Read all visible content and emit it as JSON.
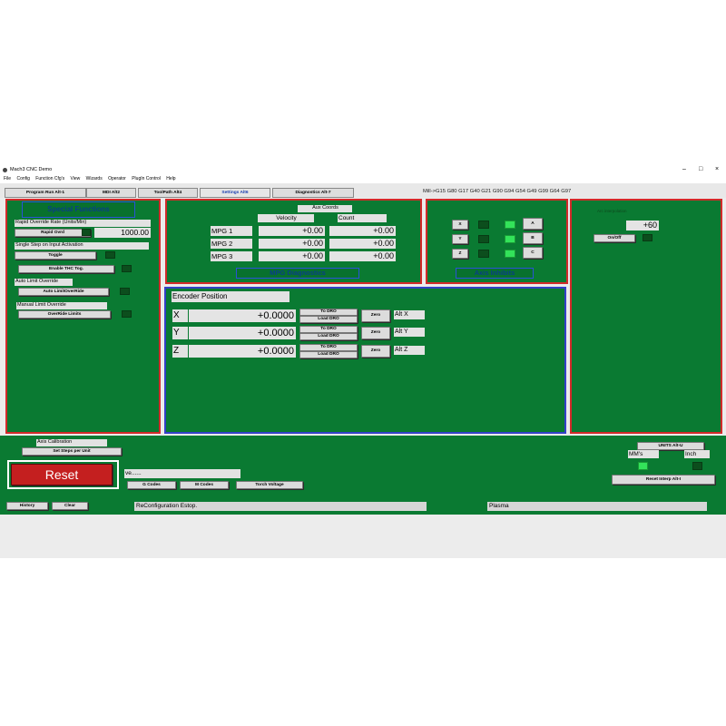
{
  "window": {
    "title": "Mach3 CNC Demo",
    "controls": [
      "–",
      "□",
      "×"
    ]
  },
  "menu": [
    "File",
    "Config",
    "Function Cfg's",
    "View",
    "Wizards",
    "Operator",
    "PlugIn Control",
    "Help"
  ],
  "tabs": [
    "Program Run Alt-1",
    "MDI Alt2",
    "ToolPath Alt4",
    "Settings Alt6",
    "Diagnostics Alt-7"
  ],
  "active_tab": "Settings Alt6",
  "gcode_line": "Mill->G15  G80 G17 G40 G21 G90 G94 G54 G49 G99 G64 G97",
  "special": {
    "title": "Special Functions",
    "rapid_override_label": "Rapid Override Rate (Units/Min)",
    "rapid_override_button": "Rapid Ovrd",
    "rapid_value": "1000.00",
    "single_step_label": "Single Step on Input Activation",
    "toggle_button": "Toggle",
    "enable_thc_button": "Enable THC Tog.",
    "auto_limit_label": "Auto Limit Override",
    "auto_limit_button": "Auto LimitOverRide",
    "manual_limit_label": "Manual Limit Override",
    "override_limits_button": "OverRide Limits"
  },
  "mpg": {
    "title": "MPG Diagnostics",
    "aux_coords": "Aux Coords",
    "velocity_header": "Velocity",
    "count_header": "Count",
    "rows": [
      {
        "name": "MPG 1",
        "velocity": "+0.00",
        "count": "+0.00"
      },
      {
        "name": "MPG 2",
        "velocity": "+0.00",
        "count": "+0.00"
      },
      {
        "name": "MPG 3",
        "velocity": "+0.00",
        "count": "+0.00"
      }
    ]
  },
  "axis_inhibits": {
    "title": "Axis Inhibits",
    "left_axes": [
      "X",
      "Y",
      "Z"
    ],
    "right_axes": [
      "A",
      "B",
      "C"
    ],
    "left_led_on": [
      false,
      false,
      false
    ],
    "right_led_on": [
      true,
      true,
      true
    ]
  },
  "interpolation": {
    "label": "Arc interpolation",
    "value": "+60",
    "onoff_button": "On/Off"
  },
  "encoder": {
    "title": "Encoder Position",
    "rows": [
      {
        "axis": "X",
        "value": "+0.0000",
        "to_dro": "To DRO",
        "load_dro": "Load DRO",
        "zero": "Zero",
        "alt": "Alt X"
      },
      {
        "axis": "Y",
        "value": "+0.0000",
        "to_dro": "To DRO",
        "load_dro": "Load DRO",
        "zero": "Zero",
        "alt": "Alt Y"
      },
      {
        "axis": "Z",
        "value": "+0.0000",
        "to_dro": "To DRO",
        "load_dro": "Load DRO",
        "zero": "Zero",
        "alt": "Alt Z"
      }
    ]
  },
  "bottom": {
    "axis_calibration_label": "Axis Calibration",
    "set_steps_button": "Set Steps per Unit",
    "reset_button": "Reset",
    "history_button": "History",
    "clear_button": "Clear",
    "save_label": "ve......",
    "gcodes_button": "G Codes",
    "mcodes_button": "M Codes",
    "torch_voltage_button": "Torch Voltage",
    "units_button": "UNITS Alt-U",
    "mm_label": "MM's",
    "inch_label": "Inch",
    "reset_interp_button": "Reset Interp Alt-I",
    "status_message": "ReConfiguration Estop.",
    "profile": "Plasma"
  },
  "colors": {
    "panel_green": "#0a7a32",
    "border_red": "#d22a2a",
    "border_blue": "#3440c8",
    "reset_red": "#c41f1f",
    "led_on": "#33e35a"
  }
}
